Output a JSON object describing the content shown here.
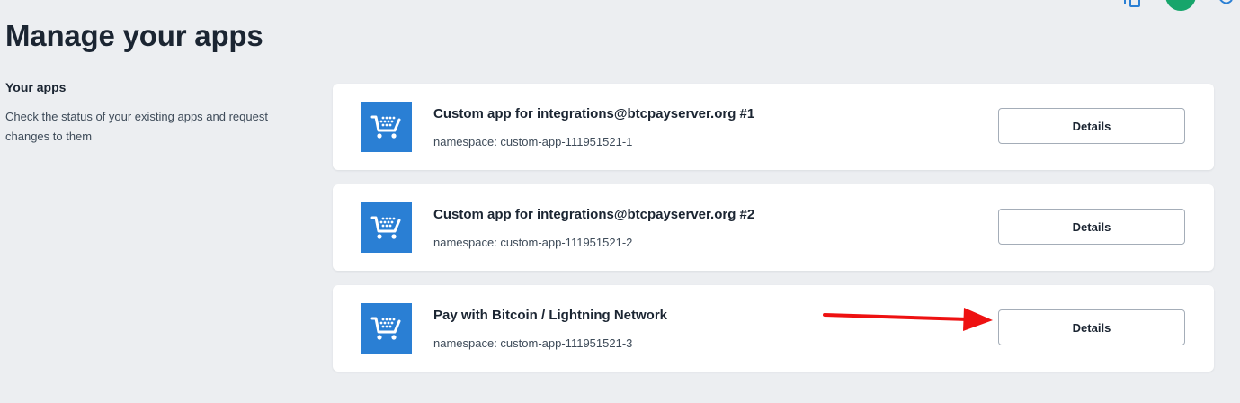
{
  "header": {
    "icons": [
      "share-icon",
      "avatar",
      "chat-icon"
    ],
    "avatar_color": "#17a56b"
  },
  "page": {
    "title": "Manage your apps"
  },
  "sidebar": {
    "heading": "Your apps",
    "description": "Check the status of your existing apps and request changes to them"
  },
  "apps": [
    {
      "title": "Custom app for integrations@btcpayserver.org #1",
      "namespace": "namespace: custom-app-111951521-1",
      "button_label": "Details"
    },
    {
      "title": "Custom app for integrations@btcpayserver.org #2",
      "namespace": "namespace: custom-app-111951521-2",
      "button_label": "Details"
    },
    {
      "title": "Pay with Bitcoin / Lightning Network",
      "namespace": "namespace: custom-app-111951521-3",
      "button_label": "Details"
    }
  ],
  "colors": {
    "background": "#eceef1",
    "app_logo": "#2a7fd4",
    "annotation_arrow": "#ee1111"
  }
}
